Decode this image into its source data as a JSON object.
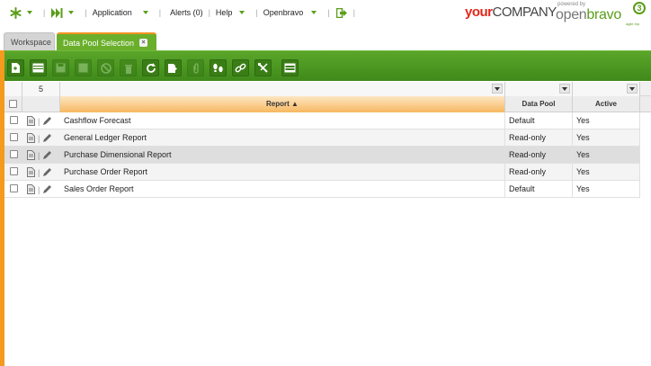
{
  "nav": {
    "application_label": "Application",
    "alerts_label": "Alerts (0)",
    "help_label": "Help",
    "user_label": "Openbravo"
  },
  "logos": {
    "company_your": "your",
    "company_rest": "COMPANY",
    "powered_by": "powered by",
    "openbravo_a": "open",
    "openbravo_b": "bravo",
    "openbravo_version": "3",
    "openbravo_tag": "agile erp"
  },
  "tabs": [
    {
      "label": "Workspace"
    },
    {
      "label": "Data Pool Selection",
      "close": "×"
    }
  ],
  "toolbar": {
    "buttons": [
      {
        "name": "new-document-icon",
        "enabled": true
      },
      {
        "name": "new-row-icon",
        "enabled": true
      },
      {
        "name": "save-icon",
        "enabled": false
      },
      {
        "name": "save-close-icon",
        "enabled": false
      },
      {
        "name": "undo-icon",
        "enabled": false
      },
      {
        "name": "delete-icon",
        "enabled": false
      },
      {
        "name": "refresh-icon",
        "enabled": true
      },
      {
        "name": "export-icon",
        "enabled": true
      },
      {
        "name": "attach-icon",
        "enabled": false
      },
      {
        "name": "audit-trail-icon",
        "enabled": true
      },
      {
        "name": "link-icon",
        "enabled": true
      },
      {
        "name": "tools-icon",
        "enabled": true
      },
      {
        "name": "grid-view-icon",
        "enabled": true
      }
    ]
  },
  "grid": {
    "record_count": "5",
    "columns": {
      "report": "Report ▲",
      "data_pool": "Data Pool",
      "active": "Active"
    },
    "rows": [
      {
        "report": "Cashflow Forecast",
        "data_pool": "Default",
        "active": "Yes"
      },
      {
        "report": "General Ledger Report",
        "data_pool": "Read-only",
        "active": "Yes"
      },
      {
        "report": "Purchase Dimensional Report",
        "data_pool": "Read-only",
        "active": "Yes"
      },
      {
        "report": "Purchase Order Report",
        "data_pool": "Read-only",
        "active": "Yes"
      },
      {
        "report": "Sales Order Report",
        "data_pool": "Default",
        "active": "Yes"
      }
    ]
  },
  "colors": {
    "brand_green": "#5a9e1a",
    "toolbar_green": "#4a961f",
    "accent_orange": "#f49a1e",
    "company_red": "#e2271b"
  }
}
